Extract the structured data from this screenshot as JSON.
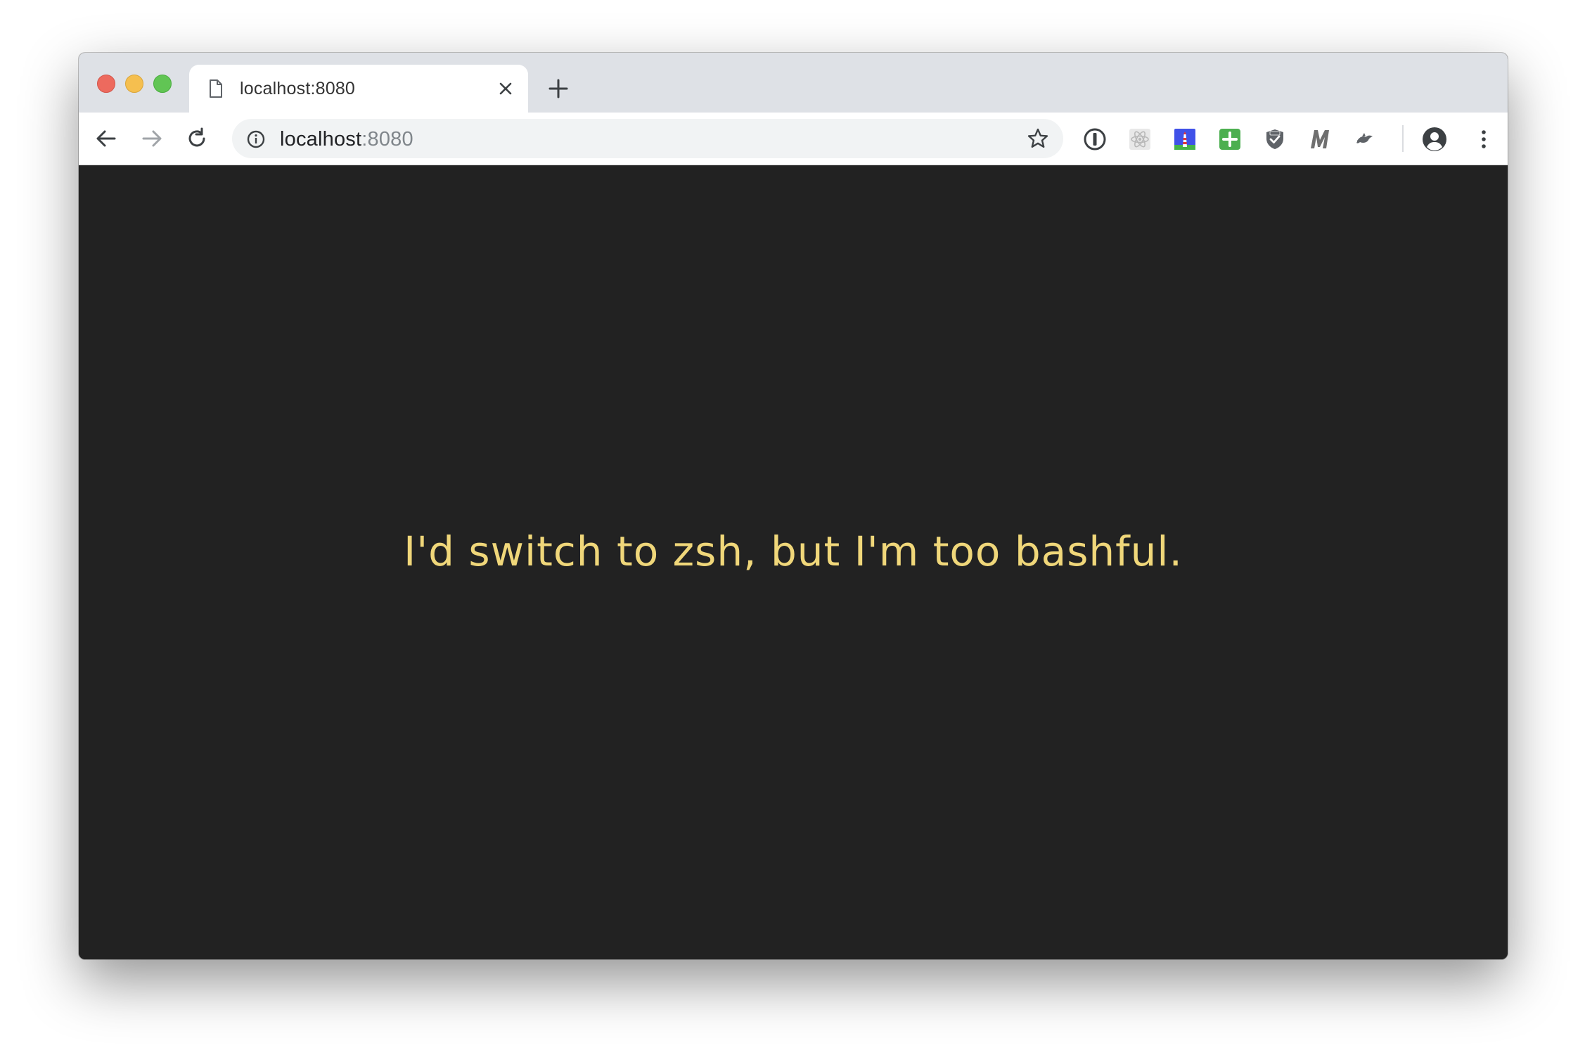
{
  "browser": {
    "tab": {
      "title": "localhost:8080",
      "icon": "page-icon",
      "close_icon": "close-icon"
    },
    "new_tab_icon": "plus-icon",
    "toolbar": {
      "back_icon": "back-arrow-icon",
      "forward_icon": "forward-arrow-icon",
      "reload_icon": "reload-icon",
      "address": {
        "host": "localhost",
        "port": ":8080",
        "info_icon": "info-icon",
        "bookmark_icon": "star-icon"
      },
      "extensions": [
        "onepassword-icon",
        "react-devtools-icon",
        "lighthouse-icon",
        "green-plus-extension-icon",
        "csp-shield-icon",
        "m-extension-icon",
        "bird-extension-icon"
      ],
      "profile_icon": "profile-avatar-icon",
      "menu_icon": "more-vertical-icon"
    }
  },
  "page": {
    "text": "I'd switch to zsh, but I'm too bashful.",
    "background": "#222222",
    "text_color": "#f0d77a"
  }
}
